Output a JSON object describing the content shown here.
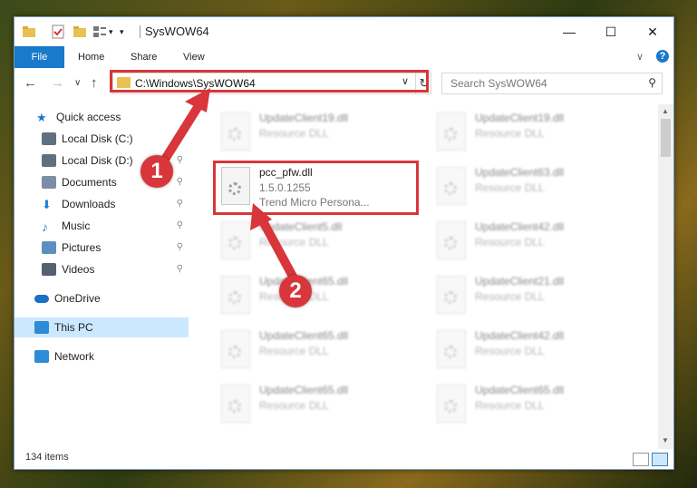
{
  "window": {
    "title": "SysWOW64",
    "minimize_symbol": "—",
    "maximize_symbol": "☐",
    "close_symbol": "✕"
  },
  "ribbon": {
    "tabs": [
      "File",
      "Home",
      "Share",
      "View"
    ],
    "expand_symbol": "∨",
    "help_symbol": "?"
  },
  "navigation": {
    "back_symbol": "←",
    "forward_symbol": "→",
    "recent_symbol": "∨",
    "up_symbol": "↑",
    "address": "C:\\Windows\\SysWOW64",
    "address_dropdown_symbol": "∨",
    "refresh_symbol": "↻",
    "search_placeholder": "Search SysWOW64",
    "search_symbol": "⚲"
  },
  "sidebar": {
    "items": [
      {
        "label": "Quick access",
        "icon": "star-icon",
        "color": "#1979ca"
      },
      {
        "label": "Local Disk (C:)",
        "icon": "drive-icon",
        "color": "#607080",
        "pinned": true
      },
      {
        "label": "Local Disk (D:)",
        "icon": "drive-icon",
        "color": "#607080",
        "pinned": true
      },
      {
        "label": "Documents",
        "icon": "documents-icon",
        "color": "#7a8fa6",
        "pinned": true
      },
      {
        "label": "Downloads",
        "icon": "downloads-icon",
        "color": "#1f7fd8",
        "pinned": true
      },
      {
        "label": "Music",
        "icon": "music-icon",
        "color": "#3d79c7",
        "pinned": true
      },
      {
        "label": "Pictures",
        "icon": "pictures-icon",
        "color": "#5b8fbf",
        "pinned": true
      },
      {
        "label": "Videos",
        "icon": "videos-icon",
        "color": "#556070",
        "pinned": true
      },
      {
        "label": "OneDrive",
        "icon": "cloud-icon",
        "color": "#1a6fc8"
      },
      {
        "label": "This PC",
        "icon": "computer-icon",
        "color": "#2e8bd8",
        "selected": true
      },
      {
        "label": "Network",
        "icon": "network-icon",
        "color": "#2e8bd8"
      }
    ],
    "pin_symbol": "📌"
  },
  "files": {
    "highlighted": {
      "name": "pcc_pfw.dll",
      "version": "1.5.0.1255",
      "company": "Trend Micro Persona..."
    },
    "left_column": [
      {
        "name": "UpdateClient19.dll",
        "desc": "Resource DLL"
      },
      {
        "name": "UpdateClient5.dll",
        "desc": "Resource DLL"
      },
      {
        "name": "UpdateClient65.dll",
        "desc": "Resource DLL"
      },
      {
        "name": "UpdateClient65.dll",
        "desc": "Resource DLL"
      },
      {
        "name": "UpdateClient65.dll",
        "desc": "Resource DLL"
      }
    ],
    "right_column": [
      {
        "name": "UpdateClient19.dll",
        "desc": "Resource DLL"
      },
      {
        "name": "UpdateClient63.dll",
        "desc": "Resource DLL"
      },
      {
        "name": "UpdateClient42.dll",
        "desc": "Resource DLL"
      },
      {
        "name": "UpdateClient21.dll",
        "desc": "Resource DLL"
      },
      {
        "name": "UpdateClient42.dll",
        "desc": "Resource DLL"
      },
      {
        "name": "UpdateClient65.dll",
        "desc": "Resource DLL"
      }
    ]
  },
  "status": {
    "item_count": "134 items"
  },
  "callouts": {
    "step1": "1",
    "step2": "2",
    "color": "#d8363a"
  }
}
